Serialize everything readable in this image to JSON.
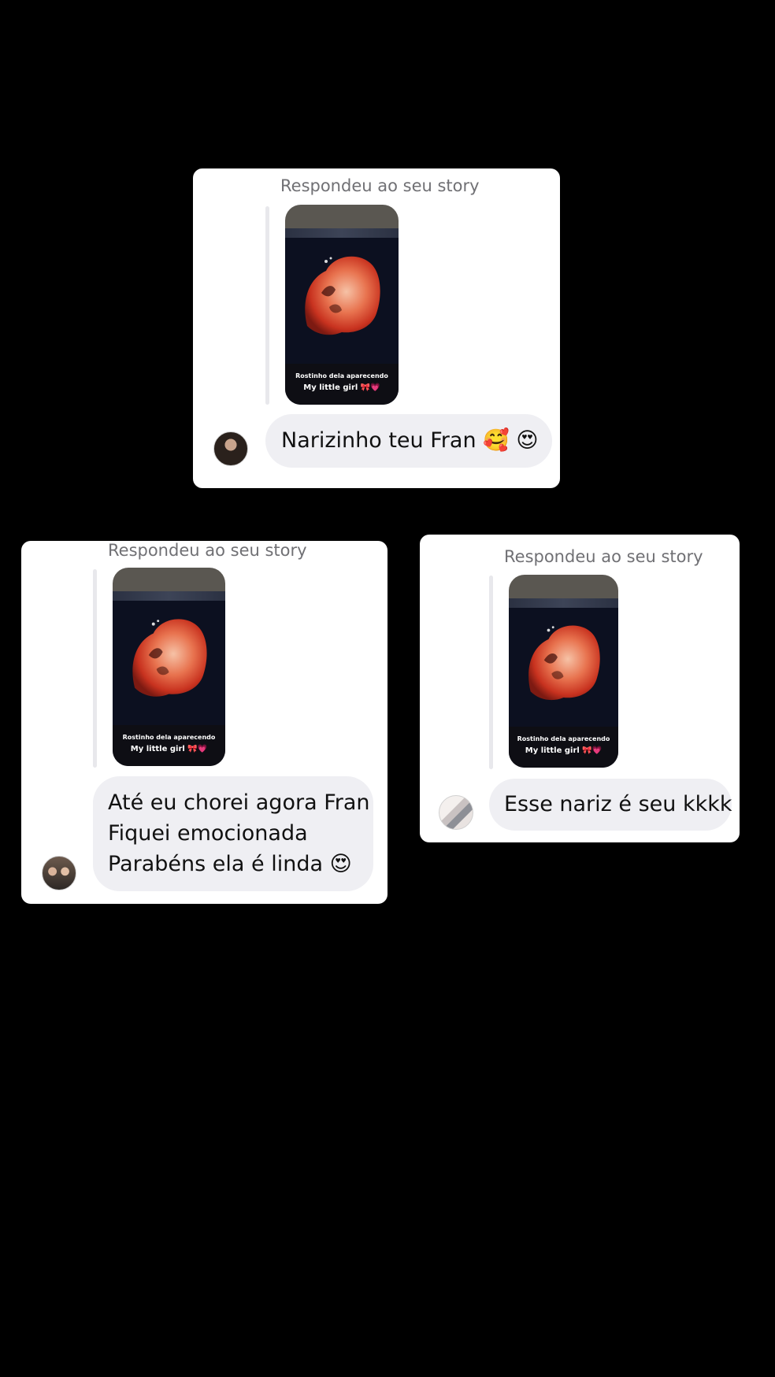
{
  "replies": [
    {
      "header": "Respondeu ao seu story",
      "story": {
        "caption_line1": "Rostinho dela aparecendo",
        "caption_line2": "My little girl 🎀💗"
      },
      "message_lines": [
        "Narizinho teu Fran 🥰 😍"
      ]
    },
    {
      "header": "Respondeu ao seu story",
      "story": {
        "caption_line1": "Rostinho dela aparecendo",
        "caption_line2": "My little girl 🎀💗"
      },
      "message_lines": [
        "Até eu chorei agora Fran",
        "Fiquei emocionada",
        "Parabéns ela é linda 😍"
      ]
    },
    {
      "header": "Respondeu ao seu story",
      "story": {
        "caption_line1": "Rostinho dela aparecendo",
        "caption_line2": "My little girl 🎀💗"
      },
      "message_lines": [
        "Esse nariz é seu kkkk"
      ]
    }
  ],
  "sticker": "😍"
}
